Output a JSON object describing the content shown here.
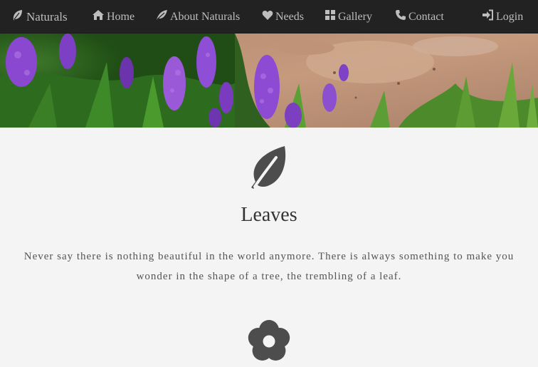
{
  "nav": {
    "brand": {
      "label": "Naturals",
      "icon": "leaf-icon"
    },
    "items": [
      {
        "label": "Home",
        "icon": "home-icon"
      },
      {
        "label": "About Naturals",
        "icon": "leaf-icon"
      },
      {
        "label": "Needs",
        "icon": "heart-icon"
      },
      {
        "label": "Gallery",
        "icon": "grid-icon"
      },
      {
        "label": "Contact",
        "icon": "phone-icon"
      }
    ],
    "login": {
      "label": "Login",
      "icon": "login-icon"
    }
  },
  "banner": {
    "image": "purple-lupine-flowers-photo"
  },
  "sections": [
    {
      "icon": "leaf-icon",
      "title": "Leaves",
      "text": "Never say there is nothing beautiful in the world anymore. There is always something to make you wonder in the shape of a tree, the trembling of a leaf."
    },
    {
      "icon": "flower-icon"
    }
  ],
  "colors": {
    "navbar": "#222222",
    "nav_text": "#bdbdbd",
    "background": "#f4f4f4",
    "icon": "#4d4d4d",
    "heading": "#333333",
    "body_text": "#555555"
  }
}
